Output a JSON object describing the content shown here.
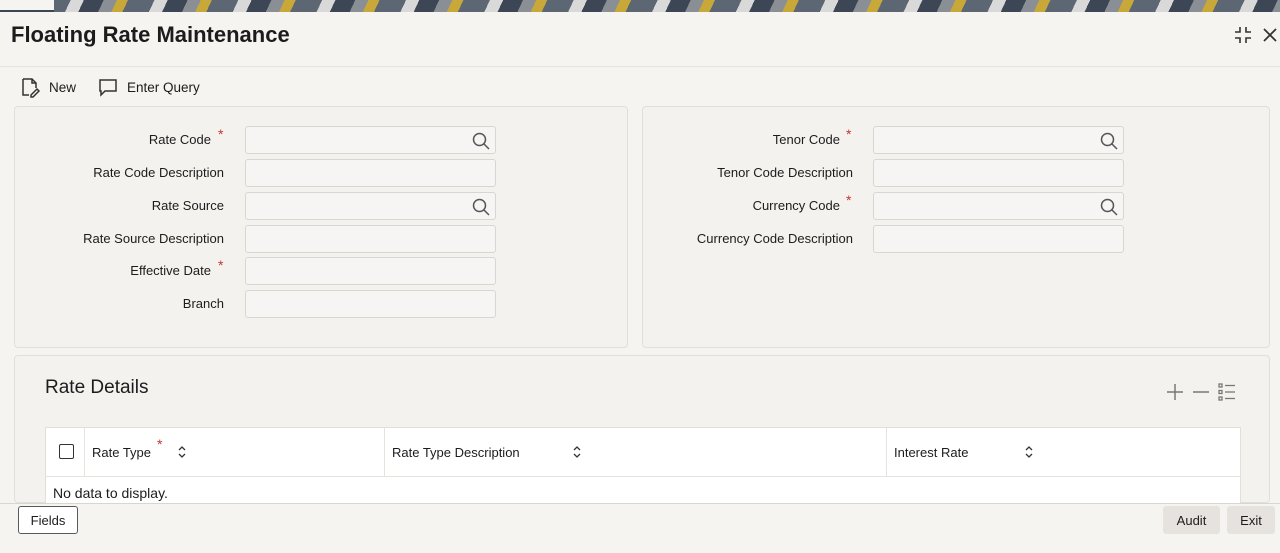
{
  "header": {
    "title": "Floating Rate Maintenance"
  },
  "toolbar": {
    "new_label": "New",
    "query_label": "Enter Query"
  },
  "left_panel": {
    "rate_code": {
      "label": "Rate Code",
      "value": "",
      "required": "*"
    },
    "rate_code_desc": {
      "label": "Rate Code Description",
      "value": ""
    },
    "rate_source": {
      "label": "Rate Source",
      "value": ""
    },
    "rate_source_desc": {
      "label": "Rate Source Description",
      "value": ""
    },
    "effective_date": {
      "label": "Effective Date",
      "value": "",
      "required": "*"
    },
    "branch": {
      "label": "Branch",
      "value": ""
    }
  },
  "right_panel": {
    "tenor_code": {
      "label": "Tenor Code",
      "value": "",
      "required": "*"
    },
    "tenor_code_desc": {
      "label": "Tenor Code Description",
      "value": ""
    },
    "currency_code": {
      "label": "Currency Code",
      "value": "",
      "required": "*"
    },
    "currency_code_desc": {
      "label": "Currency Code Description",
      "value": ""
    }
  },
  "rate_details": {
    "title": "Rate Details",
    "columns": {
      "rate_type": "Rate Type",
      "rate_type_required": "*",
      "rate_type_desc": "Rate Type Description",
      "interest_rate": "Interest Rate"
    },
    "empty_message": "No data to display."
  },
  "footer": {
    "fields_label": "Fields",
    "audit_label": "Audit",
    "exit_label": "Exit"
  },
  "colors": {
    "required": "#c0392b",
    "background": "#f6f4f1",
    "panel": "#f4f2ef"
  },
  "icons": {
    "new": "new-document-icon",
    "query": "chat-bubble-icon",
    "search": "search-icon",
    "add": "plus-icon",
    "remove": "minus-icon",
    "columns": "list-icon",
    "sort": "sort-icon",
    "minimize": "collapse-icon",
    "close": "close-icon"
  }
}
